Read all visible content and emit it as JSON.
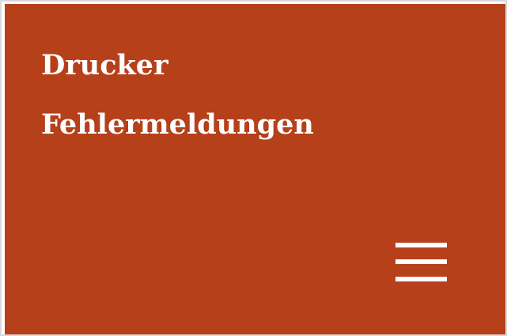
{
  "header": {
    "title_line1": "Drucker",
    "title_line2": "Fehlermeldungen",
    "background_color": "#b5401a",
    "text_color": "#ffffff",
    "menu_icon": "hamburger-menu-icon"
  }
}
